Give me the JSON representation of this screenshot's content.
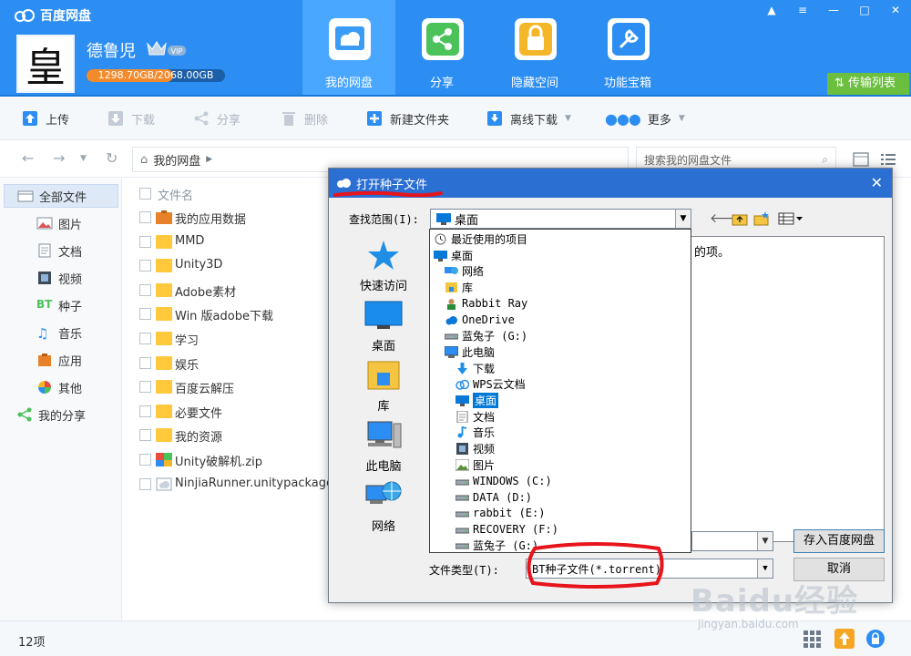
{
  "app": {
    "title": "百度网盘",
    "user": {
      "name": "德鲁児",
      "avatar_char": "皇",
      "vip_label": "VIP",
      "quota_text": "1298.70GB/2068.00GB",
      "quota_fraction": 0.628
    },
    "nav_tabs": [
      {
        "label": "我的网盘",
        "icon": "cloud-drive-icon",
        "active": true,
        "color": "#ffffff"
      },
      {
        "label": "分享",
        "icon": "share-icon",
        "color": "#4cc25a"
      },
      {
        "label": "隐藏空间",
        "icon": "lock-icon",
        "color": "#f5b72a"
      },
      {
        "label": "功能宝箱",
        "icon": "toolbox-icon",
        "color": "#2c8ef2"
      }
    ],
    "window_controls": [
      "▲",
      "≡",
      "—",
      "□",
      "✕"
    ],
    "transfer_label": "传输列表"
  },
  "toolbar": [
    {
      "label": "上传",
      "icon": "upload-icon",
      "disabled": false
    },
    {
      "label": "下载",
      "icon": "download-icon",
      "disabled": true
    },
    {
      "label": "分享",
      "icon": "share-icon",
      "disabled": true
    },
    {
      "label": "删除",
      "icon": "trash-icon",
      "disabled": true
    },
    {
      "label": "新建文件夹",
      "icon": "new-folder-icon",
      "disabled": false
    },
    {
      "label": "离线下载",
      "icon": "offline-download-icon",
      "disabled": false,
      "has_dropdown": true
    },
    {
      "label": "更多",
      "icon": "more-icon",
      "disabled": false,
      "has_dropdown": true
    }
  ],
  "address": {
    "path": "我的网盘",
    "search_placeholder": "搜索我的网盘文件"
  },
  "sidebar": [
    {
      "label": "全部文件",
      "icon": "all-files-icon",
      "active": true,
      "sub": false
    },
    {
      "label": "图片",
      "icon": "image-icon",
      "sub": true
    },
    {
      "label": "文档",
      "icon": "document-icon",
      "sub": true
    },
    {
      "label": "视频",
      "icon": "video-icon",
      "sub": true
    },
    {
      "label": "种子",
      "icon": "bt-icon",
      "icon_text": "BT",
      "sub": true
    },
    {
      "label": "音乐",
      "icon": "music-icon",
      "sub": true
    },
    {
      "label": "应用",
      "icon": "app-icon",
      "sub": true
    },
    {
      "label": "其他",
      "icon": "other-icon",
      "sub": true
    },
    {
      "label": "我的分享",
      "icon": "my-share-icon",
      "sub": false
    }
  ],
  "file_list": {
    "header": "文件名",
    "rows": [
      {
        "name": "我的应用数据",
        "type": "app-folder"
      },
      {
        "name": "MMD",
        "type": "folder"
      },
      {
        "name": "Unity3D",
        "type": "folder"
      },
      {
        "name": "Adobe素材",
        "type": "folder"
      },
      {
        "name": "Win 版adobe下载",
        "type": "folder"
      },
      {
        "name": "学习",
        "type": "folder"
      },
      {
        "name": "娱乐",
        "type": "folder"
      },
      {
        "name": "百度云解压",
        "type": "folder"
      },
      {
        "name": "必要文件",
        "type": "folder"
      },
      {
        "name": "我的资源",
        "type": "folder"
      },
      {
        "name": "Unity破解机.zip",
        "type": "zip"
      },
      {
        "name": "NinjiaRunner.unitypackage",
        "type": "package"
      }
    ]
  },
  "status": {
    "item_count": "12项"
  },
  "watermark": {
    "text": "Baidu经验",
    "url": "jingyan.baidu.com"
  },
  "dialog": {
    "title": "打开种子文件",
    "look_in_label": "查找范围(I):",
    "look_in_value": "桌面",
    "empty_message": "的项。",
    "places": [
      {
        "label": "快速访问",
        "icon": "quick-access-icon"
      },
      {
        "label": "桌面",
        "icon": "desktop-icon"
      },
      {
        "label": "库",
        "icon": "library-icon"
      },
      {
        "label": "此电脑",
        "icon": "this-pc-icon"
      },
      {
        "label": "网络",
        "icon": "network-icon"
      }
    ],
    "dropdown_items": [
      {
        "label": "最近使用的项目",
        "icon": "recent-icon",
        "indent": 0
      },
      {
        "label": "桌面",
        "icon": "desktop-icon",
        "indent": 0
      },
      {
        "label": "网络",
        "icon": "network-icon",
        "indent": 1
      },
      {
        "label": "库",
        "icon": "library-icon",
        "indent": 1
      },
      {
        "label": "Rabbit Ray",
        "icon": "user-icon",
        "indent": 1
      },
      {
        "label": "OneDrive",
        "icon": "onedrive-icon",
        "indent": 1
      },
      {
        "label": "蓝兔子 (G:)",
        "icon": "drive-icon",
        "indent": 1
      },
      {
        "label": "此电脑",
        "icon": "this-pc-icon",
        "indent": 1
      },
      {
        "label": "下载",
        "icon": "download-icon",
        "indent": 2
      },
      {
        "label": "WPS云文档",
        "icon": "cloud-doc-icon",
        "indent": 2
      },
      {
        "label": "桌面",
        "icon": "desktop-icon",
        "indent": 2,
        "selected": true
      },
      {
        "label": "文档",
        "icon": "document-icon",
        "indent": 2
      },
      {
        "label": "音乐",
        "icon": "music-icon",
        "indent": 2
      },
      {
        "label": "视频",
        "icon": "video-icon",
        "indent": 2
      },
      {
        "label": "图片",
        "icon": "image-icon",
        "indent": 2
      },
      {
        "label": "WINDOWS (C:)",
        "icon": "drive-icon",
        "indent": 2
      },
      {
        "label": "DATA (D:)",
        "icon": "drive-icon",
        "indent": 2
      },
      {
        "label": "rabbit (E:)",
        "icon": "drive-icon",
        "indent": 2
      },
      {
        "label": "RECOVERY (F:)",
        "icon": "drive-icon",
        "indent": 2
      },
      {
        "label": "蓝兔子 (G:)",
        "icon": "drive-icon",
        "indent": 2
      }
    ],
    "file_type_label": "文件类型(T):",
    "file_type_value": "BT种子文件(*.torrent)",
    "save_label": "存入百度网盘",
    "cancel_label": "取消"
  },
  "colors": {
    "header": "#2c8ef2",
    "accent_green": "#6bbf3e",
    "annotation_red": "#e8141c",
    "dialog_title": "#2c6fd3",
    "selection": "#0078d7"
  }
}
